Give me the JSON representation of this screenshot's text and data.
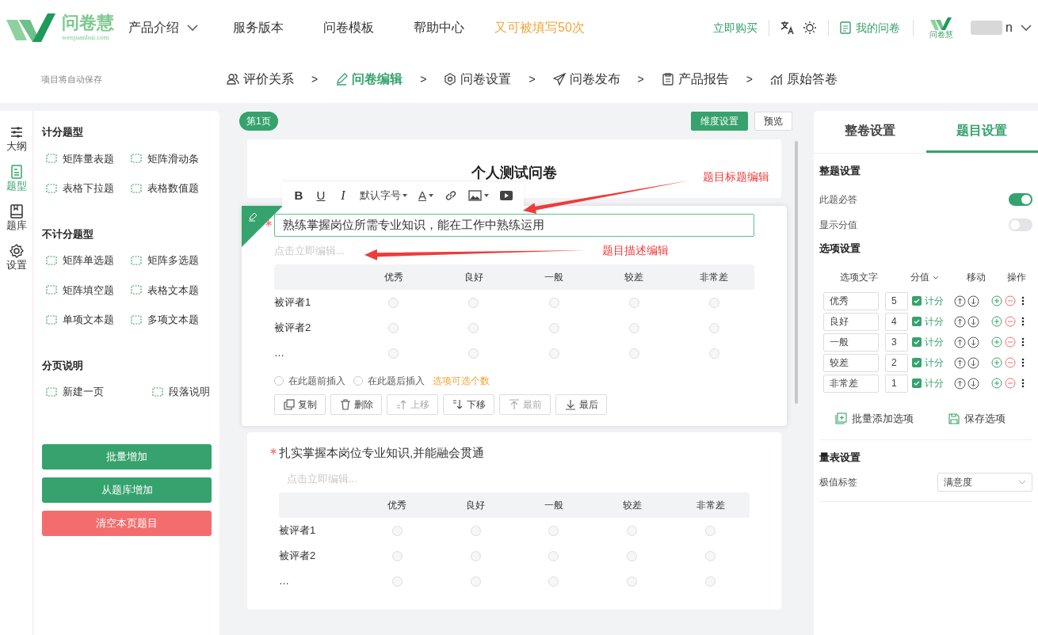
{
  "header": {
    "logo_text": "问卷慧",
    "logo_domain": "wenjuanhui.com",
    "nav": [
      {
        "label": "产品介绍",
        "dropdown": true
      },
      {
        "label": "服务版本",
        "dropdown": false
      },
      {
        "label": "问卷模板",
        "dropdown": false
      },
      {
        "label": "帮助中心",
        "dropdown": false
      }
    ],
    "promo": "又可被填写50次",
    "buy": "立即购买",
    "my_surveys": "我的问卷",
    "avatar_text": "问卷慧",
    "user_name": "n"
  },
  "subbar": {
    "autosave": "项目将自动保存",
    "steps": [
      {
        "label": "评价关系",
        "selected": false
      },
      {
        "label": "问卷编辑",
        "selected": true
      },
      {
        "label": "问卷设置",
        "selected": false
      },
      {
        "label": "问卷发布",
        "selected": false
      },
      {
        "label": "产品报告",
        "selected": false
      },
      {
        "label": "原始答卷",
        "selected": false
      }
    ],
    "separator": ">"
  },
  "rail": [
    {
      "label": "大纲",
      "selected": false
    },
    {
      "label": "题型",
      "selected": true
    },
    {
      "label": "题库",
      "selected": false
    },
    {
      "label": "设置",
      "selected": false
    }
  ],
  "question_types": [
    {
      "title": "计分题型",
      "items": [
        "矩阵量表题",
        "矩阵滑动条",
        "表格下拉题",
        "表格数值题"
      ]
    },
    {
      "title": "不计分题型",
      "items": [
        "矩阵单选题",
        "矩阵多选题",
        "矩阵填空题",
        "表格文本题",
        "单项文本题",
        "多项文本题"
      ]
    },
    {
      "title": "分页说明",
      "items": [
        "新建一页",
        "段落说明"
      ]
    }
  ],
  "left_buttons": [
    {
      "label": "批量增加",
      "kind": "primary"
    },
    {
      "label": "从题库增加",
      "kind": "primary"
    },
    {
      "label": "清空本页题目",
      "kind": "danger"
    }
  ],
  "editor": {
    "page_tag": "第1页",
    "dimension_button": "维度设置",
    "preview_button": "预览",
    "survey_title": "个人测试问卷",
    "toolbar": {
      "bold": "B",
      "underline": "U",
      "italic": "I",
      "font_size": "默认字号",
      "text_color_button": "A"
    },
    "questions": [
      {
        "required": true,
        "editing": true,
        "title": "熟练掌握岗位所需专业知识，能在工作中熟练运用",
        "description_placeholder": "点击立即编辑...",
        "columns": [
          "优秀",
          "良好",
          "一般",
          "较差",
          "非常差"
        ],
        "rows": [
          {
            "label": "被评者1",
            "checked": [
              false,
              false,
              false,
              false,
              false
            ]
          },
          {
            "label": "被评者2",
            "checked": [
              false,
              false,
              false,
              false,
              false
            ]
          },
          {
            "label": "…",
            "checked": [
              false,
              false,
              false,
              false,
              false
            ]
          }
        ],
        "insert_options": [
          "在此题前插入",
          "在此题后插入"
        ],
        "option_limit_link": "选项可选个数",
        "actions": [
          {
            "label": "复制",
            "disabled": false
          },
          {
            "label": "删除",
            "disabled": false
          },
          {
            "label": "上移",
            "disabled": true
          },
          {
            "label": "下移",
            "disabled": false
          },
          {
            "label": "最前",
            "disabled": true
          },
          {
            "label": "最后",
            "disabled": false
          }
        ]
      },
      {
        "required": true,
        "editing": false,
        "title": "扎实掌握本岗位专业知识,并能融会贯通",
        "description_placeholder": "点击立即编辑...",
        "columns": [
          "优秀",
          "良好",
          "一般",
          "较差",
          "非常差"
        ],
        "rows": [
          {
            "label": "被评者1",
            "checked": [
              false,
              false,
              false,
              false,
              false
            ]
          },
          {
            "label": "被评者2",
            "checked": [
              false,
              false,
              false,
              false,
              false
            ]
          },
          {
            "label": "…",
            "checked": [
              false,
              false,
              false,
              false,
              false
            ]
          }
        ]
      }
    ]
  },
  "annotations": [
    {
      "text": "题目标题编辑"
    },
    {
      "text": "题目描述编辑"
    }
  ],
  "right_panel": {
    "tabs": [
      {
        "label": "整卷设置",
        "selected": false
      },
      {
        "label": "题目设置",
        "selected": true
      }
    ],
    "question_settings": {
      "title": "整题设置",
      "toggles": [
        {
          "label": "此题必答",
          "on": true
        },
        {
          "label": "显示分值",
          "on": false
        }
      ]
    },
    "option_settings": {
      "title": "选项设置",
      "headers": [
        "选项文字",
        "分值",
        "移动",
        "操作"
      ],
      "options": [
        {
          "text": "优秀",
          "score": "5",
          "scored": true,
          "score_label": "计分"
        },
        {
          "text": "良好",
          "score": "4",
          "scored": true,
          "score_label": "计分"
        },
        {
          "text": "一般",
          "score": "3",
          "scored": true,
          "score_label": "计分"
        },
        {
          "text": "较差",
          "score": "2",
          "scored": true,
          "score_label": "计分"
        },
        {
          "text": "非常差",
          "score": "1",
          "scored": true,
          "score_label": "计分"
        }
      ],
      "batch_add": "批量添加选项",
      "save": "保存选项"
    },
    "scale_settings": {
      "title": "量表设置",
      "label": "极值标签",
      "value": "满意度"
    }
  }
}
